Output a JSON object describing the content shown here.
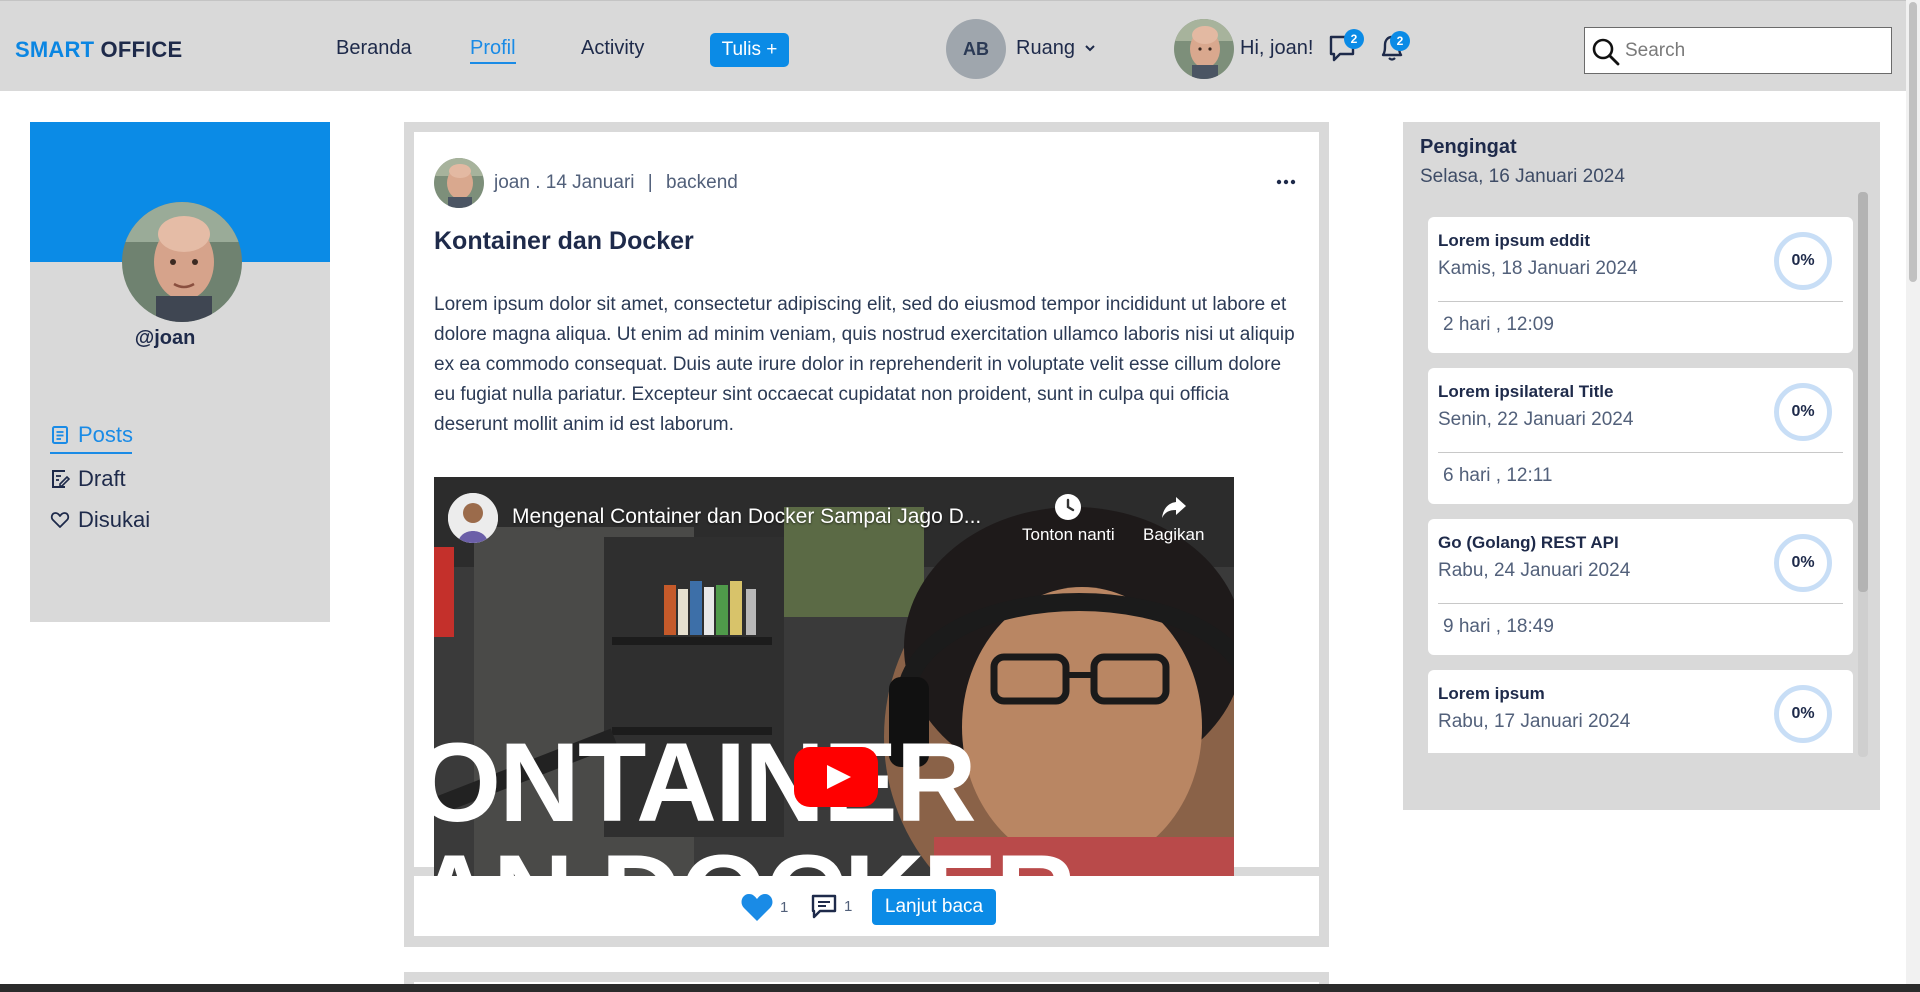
{
  "brand": {
    "part1": "SMART",
    "part2": "OFFICE"
  },
  "nav": {
    "home": "Beranda",
    "profile": "Profil",
    "activity": "Activity",
    "write": "Tulis +"
  },
  "room": {
    "initials": "AB",
    "label": "Ruang"
  },
  "user": {
    "greeting": "Hi, joan!",
    "messages_badge": "2",
    "notifications_badge": "2"
  },
  "search": {
    "placeholder": "Search",
    "value": ""
  },
  "profile": {
    "handle": "@joan",
    "menu": {
      "posts": "Posts",
      "draft": "Draft",
      "liked": "Disukai"
    }
  },
  "post": {
    "author": "joan",
    "date": ". 14 Januari",
    "separator": "|",
    "category": "backend",
    "title": "Kontainer dan Docker",
    "body": "Lorem ipsum dolor sit amet, consectetur adipiscing elit, sed do eiusmod tempor incididunt ut labore et dolore magna aliqua. Ut enim ad minim veniam, quis nostrud exercitation ullamco laboris nisi ut aliquip ex ea commodo consequat. Duis aute irure dolor in reprehenderit in voluptate velit esse cillum dolore eu fugiat nulla pariatur. Excepteur sint occaecat cupidatat non proident, sunt in culpa qui officia deserunt mollit anim id est laborum.",
    "video": {
      "title": "Mengenal Container dan Docker Sampai Jago D...",
      "watch_later": "Tonton nanti",
      "share": "Bagikan",
      "overlay_line1": "ONTAINER",
      "overlay_line2": "AN DOCKER"
    },
    "likes": "1",
    "comments": "1",
    "read_more": "Lanjut baca"
  },
  "reminders": {
    "title": "Pengingat",
    "date": "Selasa, 16 Januari 2024",
    "items": [
      {
        "title": "Lorem ipsum eddit",
        "date": "Kamis, 18 Januari 2024",
        "remaining": "2 hari , 12:09",
        "progress": "0%"
      },
      {
        "title": "Lorem ipsilateral Title",
        "date": "Senin, 22 Januari 2024",
        "remaining": "6 hari , 12:11",
        "progress": "0%"
      },
      {
        "title": "Go (Golang) REST API",
        "date": "Rabu, 24 Januari 2024",
        "remaining": "9 hari , 18:49",
        "progress": "0%"
      },
      {
        "title": "Lorem ipsum",
        "date": "Rabu, 17 Januari 2024",
        "remaining": "",
        "progress": "0%"
      }
    ]
  },
  "colors": {
    "accent": "#0b8be6",
    "panel": "#d9d9d9",
    "text": "#1e2a4a",
    "youtube": "#ff0000"
  }
}
